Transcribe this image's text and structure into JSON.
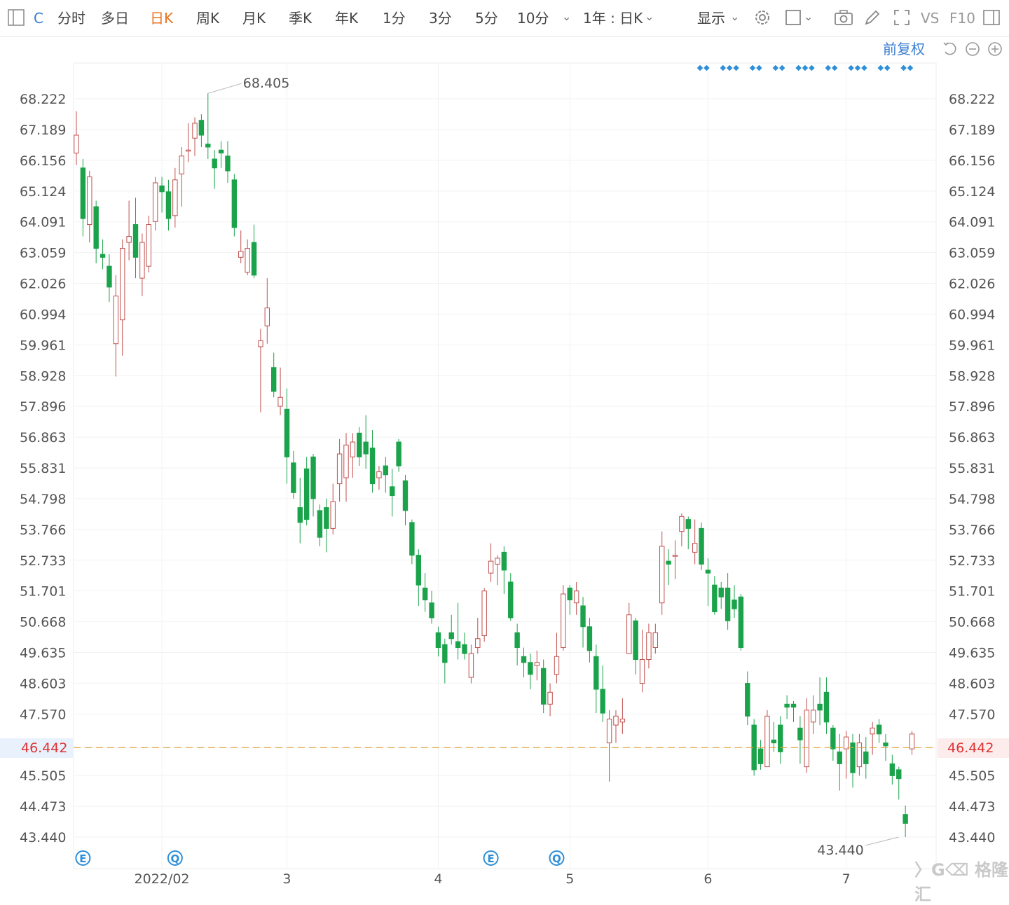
{
  "toolbar": {
    "ticker": "C",
    "periods": [
      "分时",
      "多日",
      "日K",
      "周K",
      "月K",
      "季K",
      "年K",
      "1分",
      "3分",
      "5分",
      "10分"
    ],
    "active_period": "日K",
    "range_label": "1年 : 日K",
    "display_label": "显示",
    "vs_label": "VS",
    "f10_label": "F10",
    "adjust_label": "前复权"
  },
  "colors": {
    "up": "#c0504d",
    "down": "#1aa34a",
    "current_line": "#e2a23b",
    "current_text": "#d93a3a",
    "marker": "#2e8fd8"
  },
  "chart_data": {
    "type": "candlestick",
    "title": "",
    "xlabel": "",
    "ylabel": "",
    "ylim": [
      43.44,
      68.222
    ],
    "y_ticks": [
      "68.222",
      "67.189",
      "66.156",
      "65.124",
      "64.091",
      "63.059",
      "62.026",
      "60.994",
      "59.961",
      "58.928",
      "57.896",
      "56.863",
      "55.831",
      "54.798",
      "53.766",
      "52.733",
      "51.701",
      "50.668",
      "49.635",
      "48.603",
      "47.570",
      "46.442",
      "45.505",
      "44.473",
      "43.440"
    ],
    "x_ticks": [
      {
        "label": "2022/02",
        "index": 13
      },
      {
        "label": "3",
        "index": 32
      },
      {
        "label": "4",
        "index": 55
      },
      {
        "label": "5",
        "index": 75
      },
      {
        "label": "6",
        "index": 96
      },
      {
        "label": "7",
        "index": 117
      }
    ],
    "current_price": "46.442",
    "annotations": [
      {
        "label": "68.405",
        "index": 20,
        "value": 68.405
      },
      {
        "label": "43.440",
        "index": 125,
        "value": 43.44
      }
    ],
    "event_markers": [
      {
        "label": "E",
        "index": 1
      },
      {
        "label": "Q",
        "index": 15
      },
      {
        "label": "E",
        "index": 63
      },
      {
        "label": "Q",
        "index": 73
      }
    ],
    "dividend_dot_count": 21,
    "candles": [
      [
        66.4,
        67.0,
        67.8,
        66.0
      ],
      [
        65.9,
        64.2,
        66.2,
        63.6
      ],
      [
        64.0,
        65.6,
        65.8,
        63.4
      ],
      [
        64.6,
        63.2,
        64.8,
        62.7
      ],
      [
        63.0,
        62.9,
        63.5,
        62.5
      ],
      [
        62.6,
        61.9,
        63.0,
        61.4
      ],
      [
        60.0,
        61.6,
        62.3,
        58.9
      ],
      [
        60.8,
        63.2,
        63.5,
        59.6
      ],
      [
        63.4,
        63.6,
        64.8,
        62.8
      ],
      [
        64.0,
        62.9,
        64.9,
        62.2
      ],
      [
        62.2,
        63.4,
        63.7,
        61.6
      ],
      [
        62.6,
        64.0,
        64.3,
        62.4
      ],
      [
        64.1,
        65.4,
        65.6,
        63.8
      ],
      [
        65.3,
        65.1,
        65.6,
        64.4
      ],
      [
        65.1,
        64.2,
        65.5,
        63.8
      ],
      [
        64.3,
        65.5,
        65.9,
        63.9
      ],
      [
        65.7,
        66.3,
        66.6,
        64.6
      ],
      [
        66.5,
        66.5,
        67.4,
        66.1
      ],
      [
        66.9,
        67.4,
        67.6,
        66.3
      ],
      [
        67.5,
        67.0,
        67.7,
        66.6
      ],
      [
        66.7,
        66.6,
        68.405,
        66.2
      ],
      [
        66.2,
        65.9,
        66.5,
        65.2
      ],
      [
        66.5,
        66.4,
        66.8,
        65.9
      ],
      [
        66.3,
        65.8,
        66.8,
        65.4
      ],
      [
        65.5,
        63.9,
        65.7,
        63.6
      ],
      [
        62.9,
        63.1,
        63.8,
        62.7
      ],
      [
        62.4,
        63.2,
        63.5,
        62.3
      ],
      [
        63.4,
        62.3,
        64.0,
        62.2
      ],
      [
        59.9,
        60.1,
        60.5,
        57.7
      ],
      [
        60.6,
        61.2,
        62.2,
        60.0
      ],
      [
        59.2,
        58.4,
        59.7,
        58.2
      ],
      [
        57.9,
        58.2,
        59.2,
        57.6
      ],
      [
        57.8,
        56.2,
        58.5,
        55.3
      ],
      [
        56.0,
        55.0,
        56.4,
        54.8
      ],
      [
        54.5,
        54.0,
        55.5,
        53.3
      ],
      [
        55.8,
        54.1,
        56.2,
        53.9
      ],
      [
        56.2,
        54.8,
        56.3,
        54.2
      ],
      [
        54.4,
        53.5,
        54.6,
        53.2
      ],
      [
        54.5,
        53.8,
        54.8,
        53.0
      ],
      [
        53.8,
        54.7,
        55.3,
        53.6
      ],
      [
        55.3,
        56.3,
        56.8,
        54.7
      ],
      [
        55.5,
        56.6,
        57.0,
        54.7
      ],
      [
        56.2,
        56.7,
        57.0,
        55.5
      ],
      [
        57.0,
        56.2,
        57.2,
        55.9
      ],
      [
        56.7,
        56.3,
        57.6,
        55.8
      ],
      [
        56.5,
        55.3,
        57.1,
        55.0
      ],
      [
        55.5,
        55.7,
        55.9,
        55.1
      ],
      [
        55.9,
        55.6,
        56.2,
        55.0
      ],
      [
        55.2,
        54.9,
        55.8,
        54.2
      ],
      [
        56.7,
        55.9,
        56.8,
        55.7
      ],
      [
        55.4,
        54.4,
        55.6,
        53.9
      ],
      [
        54.0,
        52.9,
        54.1,
        52.6
      ],
      [
        52.9,
        51.9,
        53.1,
        51.2
      ],
      [
        51.8,
        51.4,
        52.3,
        51.0
      ],
      [
        51.3,
        50.8,
        51.7,
        50.6
      ],
      [
        50.3,
        49.8,
        50.5,
        49.5
      ],
      [
        49.9,
        49.3,
        50.1,
        48.6
      ],
      [
        50.3,
        50.1,
        50.9,
        49.9
      ],
      [
        50.0,
        49.8,
        51.3,
        49.4
      ],
      [
        49.9,
        49.6,
        50.3,
        49.4
      ],
      [
        48.8,
        49.6,
        49.9,
        48.6
      ],
      [
        49.8,
        50.1,
        50.8,
        49.6
      ],
      [
        50.2,
        51.7,
        51.8,
        50.0
      ],
      [
        52.3,
        52.7,
        53.3,
        52.0
      ],
      [
        52.6,
        52.8,
        52.9,
        51.9
      ],
      [
        53.0,
        52.4,
        53.2,
        51.6
      ],
      [
        52.0,
        50.8,
        52.3,
        50.7
      ],
      [
        50.3,
        49.8,
        50.6,
        49.2
      ],
      [
        49.5,
        49.3,
        49.8,
        48.8
      ],
      [
        49.3,
        48.9,
        49.6,
        48.4
      ],
      [
        49.2,
        49.3,
        49.7,
        48.7
      ],
      [
        49.1,
        47.9,
        49.4,
        47.6
      ],
      [
        47.9,
        48.3,
        48.6,
        47.5
      ],
      [
        48.9,
        49.5,
        50.3,
        48.6
      ],
      [
        49.8,
        51.6,
        51.9,
        49.7
      ],
      [
        51.8,
        51.4,
        51.9,
        50.9
      ],
      [
        51.3,
        51.7,
        52.0,
        50.9
      ],
      [
        51.2,
        50.5,
        51.5,
        49.8
      ],
      [
        50.5,
        49.7,
        50.8,
        49.3
      ],
      [
        49.5,
        48.4,
        49.9,
        47.6
      ],
      [
        48.4,
        47.6,
        49.2,
        47.3
      ],
      [
        46.6,
        47.4,
        47.7,
        45.3
      ],
      [
        47.2,
        47.5,
        47.7,
        46.6
      ],
      [
        47.3,
        47.4,
        48.1,
        46.9
      ],
      [
        49.6,
        50.9,
        51.3,
        49.6
      ],
      [
        50.7,
        49.4,
        50.8,
        48.9
      ],
      [
        48.6,
        49.4,
        50.4,
        48.3
      ],
      [
        49.4,
        50.3,
        50.6,
        49.1
      ],
      [
        49.8,
        50.3,
        50.6,
        49.6
      ],
      [
        51.3,
        53.2,
        53.7,
        50.9
      ],
      [
        52.7,
        52.6,
        53.1,
        51.9
      ],
      [
        52.9,
        52.9,
        53.4,
        52.1
      ],
      [
        53.7,
        54.2,
        54.3,
        53.2
      ],
      [
        54.1,
        53.8,
        54.2,
        53.1
      ],
      [
        53.0,
        53.3,
        54.1,
        52.6
      ],
      [
        53.8,
        52.6,
        54.0,
        52.4
      ],
      [
        52.4,
        52.3,
        52.8,
        51.2
      ],
      [
        51.9,
        51.0,
        52.2,
        50.9
      ],
      [
        51.8,
        51.5,
        52.0,
        51.1
      ],
      [
        51.8,
        50.7,
        52.3,
        50.4
      ],
      [
        51.4,
        51.1,
        51.9,
        50.8
      ],
      [
        51.5,
        49.8,
        51.6,
        49.7
      ],
      [
        48.6,
        47.5,
        49.0,
        47.2
      ],
      [
        47.2,
        45.7,
        47.4,
        45.5
      ],
      [
        46.4,
        45.9,
        46.7,
        45.7
      ],
      [
        45.8,
        47.5,
        47.7,
        45.8
      ],
      [
        46.7,
        46.6,
        47.3,
        46.3
      ],
      [
        47.2,
        46.3,
        47.5,
        45.9
      ],
      [
        47.9,
        47.8,
        48.2,
        47.4
      ],
      [
        47.9,
        47.8,
        48.0,
        47.3
      ],
      [
        47.1,
        46.7,
        47.5,
        45.9
      ],
      [
        45.8,
        47.7,
        48.1,
        45.6
      ],
      [
        47.3,
        47.7,
        48.2,
        46.9
      ],
      [
        47.9,
        47.7,
        48.8,
        47.2
      ],
      [
        48.3,
        47.3,
        48.8,
        46.9
      ],
      [
        47.1,
        46.4,
        47.2,
        46.0
      ],
      [
        46.3,
        45.9,
        46.9,
        45.0
      ],
      [
        46.4,
        46.8,
        47.0,
        45.4
      ],
      [
        46.6,
        45.6,
        46.9,
        45.1
      ],
      [
        45.8,
        46.6,
        46.9,
        45.5
      ],
      [
        46.3,
        45.9,
        46.8,
        45.4
      ],
      [
        46.9,
        47.1,
        47.3,
        46.2
      ],
      [
        47.2,
        46.9,
        47.4,
        46.6
      ],
      [
        46.6,
        46.5,
        46.9,
        46.0
      ],
      [
        45.9,
        45.5,
        46.2,
        45.2
      ],
      [
        45.7,
        45.4,
        45.8,
        44.7
      ],
      [
        44.2,
        43.9,
        44.5,
        43.44
      ],
      [
        46.4,
        46.9,
        47.0,
        46.2
      ]
    ]
  }
}
